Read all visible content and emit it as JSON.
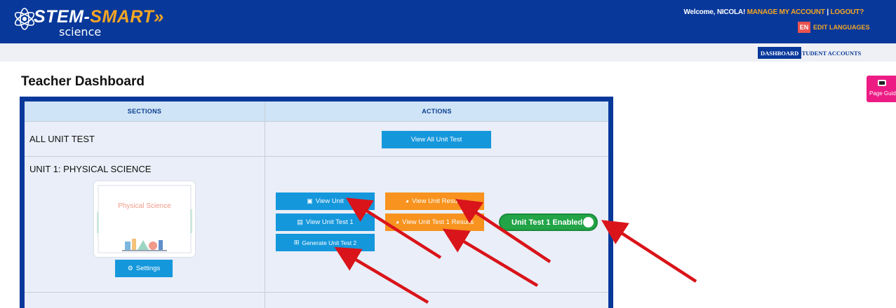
{
  "header": {
    "logo_main_stem": "STEM-",
    "logo_main_smart": "SMART",
    "logo_chevrons": "»",
    "logo_sub": "science",
    "welcome_prefix": "Welcome, ",
    "user_name": "NICOLA!",
    "manage_account": "MANAGE MY ACCOUNT",
    "separator": "|",
    "logout": "LOGOUT?",
    "lang_code": "EN",
    "edit_languages": "EDIT LANGUAGES"
  },
  "nav": {
    "dashboard": "DASHBOARD",
    "student_accounts": "STUDENT ACCOUNTS"
  },
  "page": {
    "title": "Teacher Dashboard",
    "guide_label": "Page Guide"
  },
  "table": {
    "col_sections": "SECTIONS",
    "col_actions": "ACTIONS",
    "rows": [
      {
        "section": "ALL UNIT TEST",
        "view_all": "View All Unit Test"
      },
      {
        "section": "UNIT 1: PHYSICAL SCIENCE",
        "thumbnail_title": "Physical Science",
        "settings": "Settings",
        "view_unit": "View Unit",
        "view_unit_test": "View Unit Test 1",
        "generate_test": "Generate Unit Test 2",
        "view_results": "View Unit Results",
        "view_test_results": "View Unit Test 1 Results",
        "toggle_label": "Unit Test 1 Enabled",
        "toggle_on": true
      }
    ]
  },
  "colors": {
    "brand_blue": "#08389a",
    "accent_orange": "#f5a623",
    "button_blue": "#1597dc",
    "button_orange": "#f7931e",
    "toggle_green": "#22a447",
    "guide_pink": "#ec1c84",
    "annotation_arrow": "#d9141a"
  },
  "icons": {
    "logo": "atom-icon",
    "view_unit": "image-icon",
    "view_unit_test": "document-icon",
    "generate_test": "plus-square-icon",
    "settings": "gear-icon",
    "results": "pie-chart-icon",
    "guide": "monitor-icon"
  }
}
